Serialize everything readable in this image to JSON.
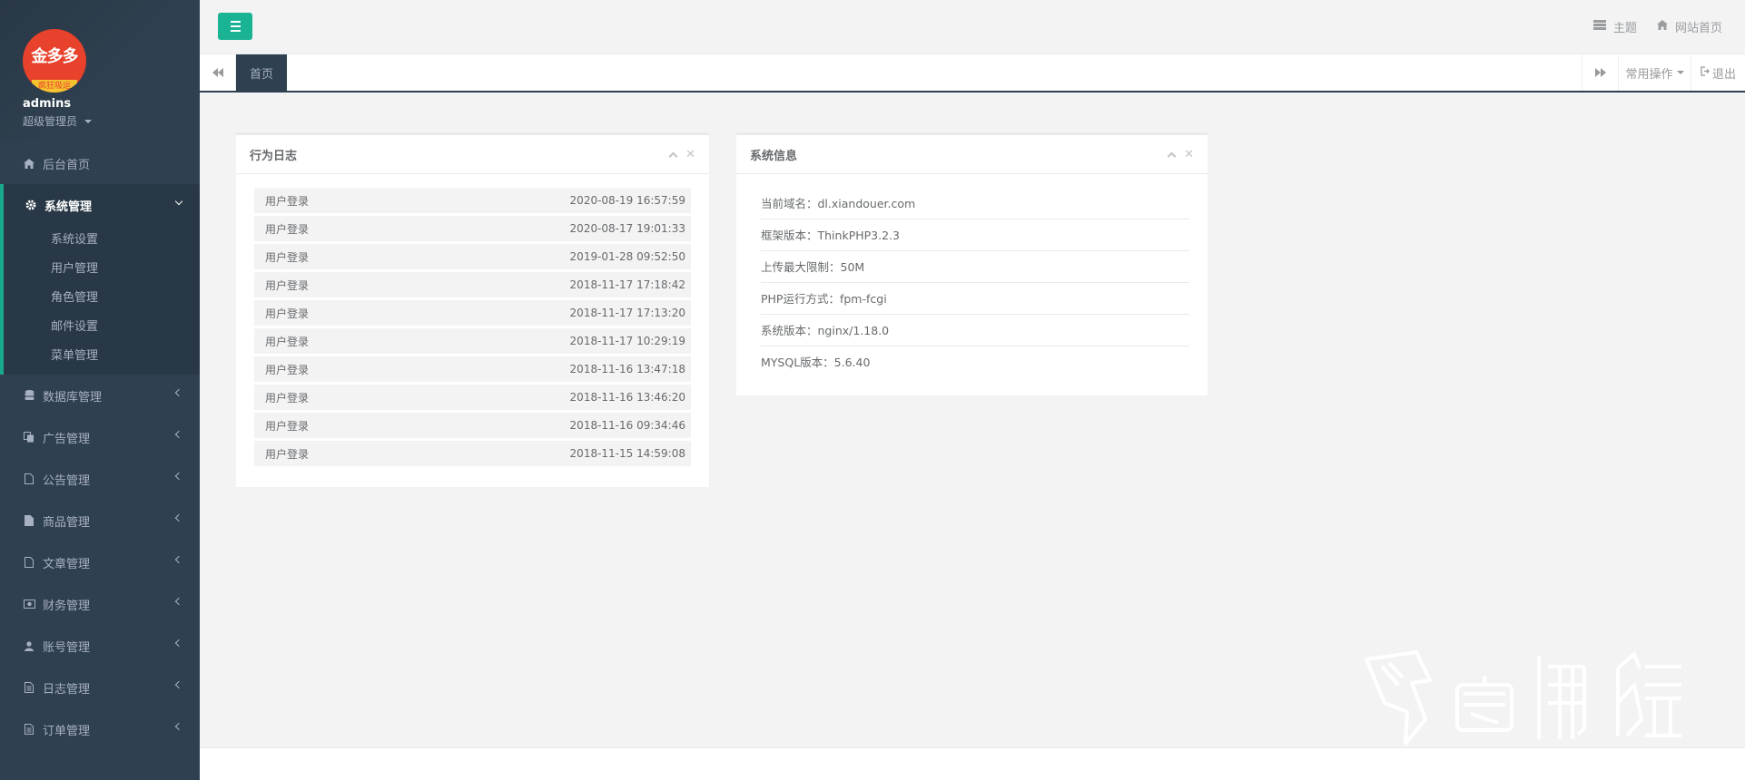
{
  "profile": {
    "avatar_text_top": "金多多",
    "avatar_text_bottom": "疯狂吸运",
    "username": "admins",
    "role": "超级管理员"
  },
  "sidebar": {
    "home": "后台首页",
    "system": {
      "label": "系统管理",
      "children": [
        "系统设置",
        "用户管理",
        "角色管理",
        "邮件设置",
        "菜单管理"
      ]
    },
    "items": [
      {
        "label": "数据库管理",
        "icon": "database-icon"
      },
      {
        "label": "广告管理",
        "icon": "copy-icon"
      },
      {
        "label": "公告管理",
        "icon": "file-outline-icon"
      },
      {
        "label": "商品管理",
        "icon": "file-icon"
      },
      {
        "label": "文章管理",
        "icon": "file-outline-icon"
      },
      {
        "label": "财务管理",
        "icon": "money-icon"
      },
      {
        "label": "账号管理",
        "icon": "user-icon"
      },
      {
        "label": "日志管理",
        "icon": "file-text-icon"
      },
      {
        "label": "订单管理",
        "icon": "file-text-icon"
      }
    ]
  },
  "topbar": {
    "theme": "主题",
    "site_home": "网站首页"
  },
  "tabs": {
    "home": "首页",
    "common_ops": "常用操作",
    "logout": "退出"
  },
  "log_panel": {
    "title": "行为日志",
    "rows": [
      {
        "action": "用户登录",
        "time": "2020-08-19 16:57:59"
      },
      {
        "action": "用户登录",
        "time": "2020-08-17 19:01:33"
      },
      {
        "action": "用户登录",
        "time": "2019-01-28 09:52:50"
      },
      {
        "action": "用户登录",
        "time": "2018-11-17 17:18:42"
      },
      {
        "action": "用户登录",
        "time": "2018-11-17 17:13:20"
      },
      {
        "action": "用户登录",
        "time": "2018-11-17 10:29:19"
      },
      {
        "action": "用户登录",
        "time": "2018-11-16 13:47:18"
      },
      {
        "action": "用户登录",
        "time": "2018-11-16 13:46:20"
      },
      {
        "action": "用户登录",
        "time": "2018-11-16 09:34:46"
      },
      {
        "action": "用户登录",
        "time": "2018-11-15 14:59:08"
      }
    ]
  },
  "sys_panel": {
    "title": "系统信息",
    "rows": [
      "当前域名：dl.xiandouer.com",
      "框架版本：ThinkPHP3.2.3",
      "上传最大限制：50M",
      "PHP运行方式：fpm-fcgi",
      "系统版本：nginx/1.18.0",
      "MYSQL版本：5.6.40"
    ]
  },
  "colors": {
    "sidebar_bg": "#2f4050",
    "accent": "#1ab394",
    "content_bg": "#f3f3f4"
  }
}
